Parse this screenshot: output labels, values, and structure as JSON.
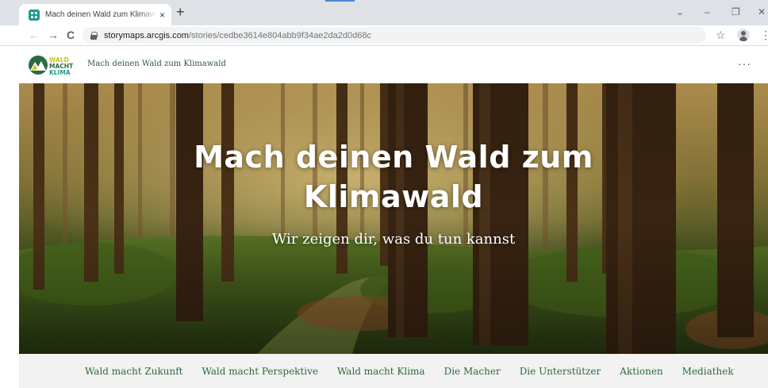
{
  "browser": {
    "tab_title": "Mach deinen Wald zum Klimawald",
    "tab_close": "×",
    "new_tab": "+",
    "window_controls": [
      "⌄",
      "–",
      "❐",
      "✕"
    ],
    "nav": {
      "back": "←",
      "forward": "→",
      "reload": "C"
    },
    "url_host": "storymaps.arcgis.com",
    "url_path": "/stories/cedbe3614e804abb9f34ae2da2d0d68c",
    "bookmark_star": "☆",
    "menu": "⋮"
  },
  "header": {
    "logo_lines": [
      "WALD",
      "MACHT",
      "KLIMA"
    ],
    "title": "Mach deinen Wald zum Klimawald",
    "more": "···"
  },
  "hero": {
    "title_line1": "Mach deinen Wald zum",
    "title_line2": "Klimawald",
    "subtitle": "Wir zeigen dir, was du tun kannst"
  },
  "nav": {
    "items": [
      "Wald macht Zukunft",
      "Wald macht Perspektive",
      "Wald macht Klima",
      "Die Macher",
      "Die Unterstützer",
      "Aktionen",
      "Mediathek"
    ]
  },
  "colors": {
    "brand_green": "#2c6b3f",
    "logo_teal": "#1e9c8a",
    "logo_yellow": "#c9c51f",
    "tab_strip": "#dee1e6",
    "nav_bar": "#f2f2f2"
  }
}
